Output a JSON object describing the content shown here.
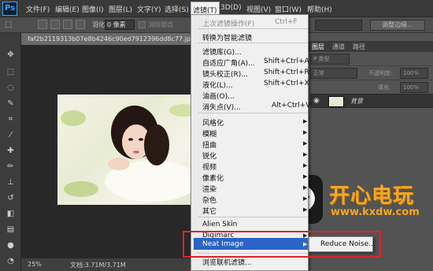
{
  "app": {
    "logo": "Ps"
  },
  "menubar": {
    "items": [
      "文件(F)",
      "编辑(E)",
      "图像(I)",
      "图层(L)",
      "文字(Y)",
      "选择(S)",
      "滤镜(T)",
      "3D(D)",
      "视图(V)",
      "窗口(W)",
      "帮助(H)"
    ]
  },
  "optionsbar": {
    "feather_label": "羽化:",
    "feather_value": "0 像素",
    "antialias_label": "消除锯齿",
    "refine_button": "调整边缘..."
  },
  "document": {
    "tab_title": "faf2b2119313b07e8b4246c90ed7912396dd8c77.jpg @ 25%",
    "zoom": "25%",
    "doc_info": "文档:3.71M/3.71M"
  },
  "panel": {
    "tabs": [
      "图层",
      "通道",
      "路径"
    ],
    "kind_label": "P 类型",
    "blend_mode": "正常",
    "opacity_label": "不透明度:",
    "opacity_value": "100%",
    "fill_label": "填充:",
    "fill_value": "100%",
    "layer_name": "背景"
  },
  "filter_menu": {
    "last_filter": "上次滤镜操作(F)",
    "last_filter_shortcut": "Ctrl+F",
    "smart_filter": "转换为智能滤镜",
    "group1": [
      {
        "label": "滤镜库(G)...",
        "shortcut": ""
      },
      {
        "label": "自适应广角(A)...",
        "shortcut": "Shift+Ctrl+A"
      },
      {
        "label": "镜头校正(R)...",
        "shortcut": "Shift+Ctrl+R"
      },
      {
        "label": "液化(L)...",
        "shortcut": "Shift+Ctrl+X"
      },
      {
        "label": "油画(O)...",
        "shortcut": ""
      },
      {
        "label": "消失点(V)...",
        "shortcut": "Alt+Ctrl+V"
      }
    ],
    "group2": [
      "风格化",
      "模糊",
      "扭曲",
      "锐化",
      "视频",
      "像素化",
      "渲染",
      "杂色",
      "其它"
    ],
    "group3": [
      "Alien Skin",
      "Digimarc",
      "Neat Image"
    ],
    "browse": "浏览联机滤镜..."
  },
  "submenu": {
    "reduce_noise": "Reduce Noise..."
  },
  "watermark": {
    "title": "开心电玩",
    "url": "www.kxdw.com"
  },
  "colors": {
    "highlight": "#2b63c6",
    "callout": "#e0212c",
    "watermark": "#f5a623"
  }
}
